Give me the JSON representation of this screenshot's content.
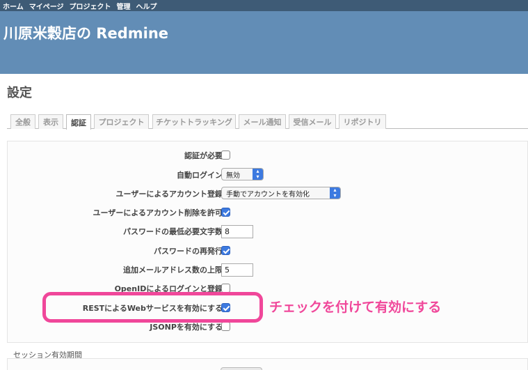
{
  "top_menu": {
    "home": "ホーム",
    "my_page": "マイページ",
    "projects": "プロジェクト",
    "admin": "管理",
    "help": "ヘルプ"
  },
  "header": {
    "title": "川原米穀店の Redmine"
  },
  "page": {
    "title": "設定"
  },
  "tabs": [
    {
      "label": "全般",
      "selected": false
    },
    {
      "label": "表示",
      "selected": false
    },
    {
      "label": "認証",
      "selected": true
    },
    {
      "label": "プロジェクト",
      "selected": false
    },
    {
      "label": "チケットトラッキング",
      "selected": false
    },
    {
      "label": "メール通知",
      "selected": false
    },
    {
      "label": "受信メール",
      "selected": false
    },
    {
      "label": "リポジトリ",
      "selected": false
    }
  ],
  "settings": {
    "login_required": {
      "label": "認証が必要",
      "checked": false
    },
    "autologin": {
      "label": "自動ログイン",
      "value": "無効"
    },
    "self_registration": {
      "label": "ユーザーによるアカウント登録",
      "value": "手動でアカウントを有効化"
    },
    "unsubscribe": {
      "label": "ユーザーによるアカウント削除を許可",
      "checked": true
    },
    "password_min_length": {
      "label": "パスワードの最低必要文字数",
      "value": "8"
    },
    "lost_password": {
      "label": "パスワードの再発行",
      "checked": true
    },
    "max_additional_emails": {
      "label": "追加メールアドレス数の上限",
      "value": "5"
    },
    "openid": {
      "label": "OpenIDによるログインと登録",
      "checked": false
    },
    "rest_api": {
      "label": "RESTによるWebサービスを有効にする",
      "checked": true
    },
    "jsonp": {
      "label": "JSONPを有効にする",
      "checked": false
    }
  },
  "annotation": {
    "text": "チェックを付けて有効にする",
    "color": "#f0479a"
  },
  "session": {
    "title": "セッション有効期間"
  },
  "colors": {
    "top_menu_bg": "#3e5b76",
    "header_bg": "#628db6",
    "checkbox_checked": "#3d7ae0"
  }
}
